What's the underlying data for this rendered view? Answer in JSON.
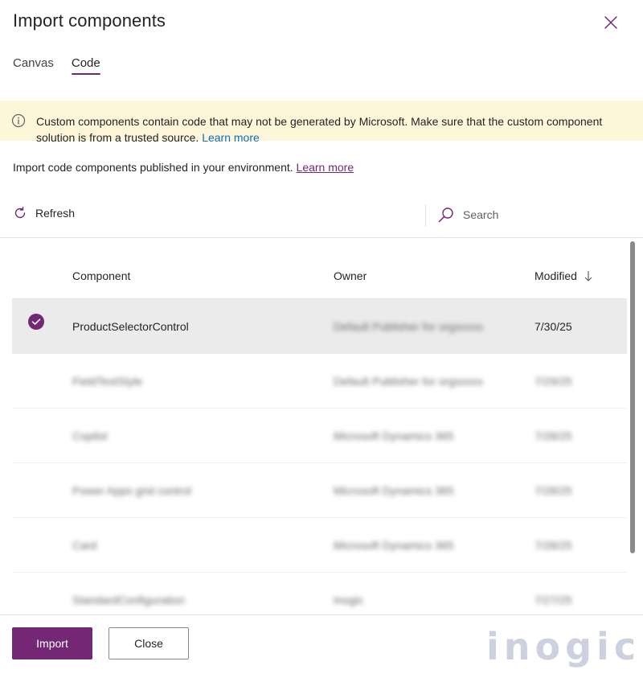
{
  "dialog": {
    "title": "Import components",
    "close_label": "Close dialog"
  },
  "tabs": [
    {
      "label": "Canvas",
      "active": false
    },
    {
      "label": "Code",
      "active": true
    }
  ],
  "banner": {
    "icon": "info-icon",
    "text": "Custom components contain code that may not be generated by Microsoft. Make sure that the custom component solution is from a trusted source. ",
    "link_text": "Learn more"
  },
  "subtitle": {
    "text": "Import code components published in your environment. ",
    "link_text": "Learn more"
  },
  "toolbar": {
    "refresh_label": "Refresh",
    "search_placeholder": "Search"
  },
  "grid": {
    "columns": {
      "component": "Component",
      "owner": "Owner",
      "modified": "Modified"
    },
    "rows": [
      {
        "component": "ProductSelectorControl",
        "owner": "Default Publisher for orgsxxxx",
        "modified": "7/30/25",
        "selected": true
      },
      {
        "component": "FieldTextStyle",
        "owner": "Default Publisher for orgsxxxx",
        "modified": "7/29/25",
        "selected": false
      },
      {
        "component": "Copilot",
        "owner": "Microsoft Dynamics 365",
        "modified": "7/28/25",
        "selected": false
      },
      {
        "component": "Power Apps grid control",
        "owner": "Microsoft Dynamics 365",
        "modified": "7/28/25",
        "selected": false
      },
      {
        "component": "Card",
        "owner": "Microsoft Dynamics 365",
        "modified": "7/28/25",
        "selected": false
      },
      {
        "component": "StandardConfiguration",
        "owner": "Inogic",
        "modified": "7/27/25",
        "selected": false
      }
    ]
  },
  "footer": {
    "import_label": "Import",
    "close_label": "Close"
  },
  "watermark": "inogic",
  "colors": {
    "accent": "#742774",
    "banner_bg": "#fdf6d8",
    "link": "#0f6cbd"
  }
}
